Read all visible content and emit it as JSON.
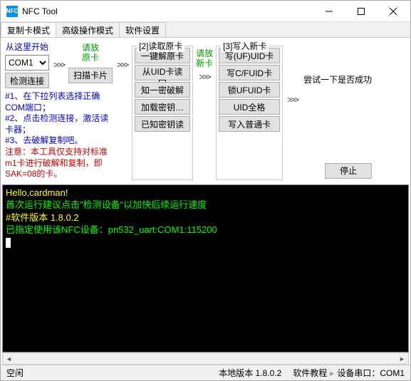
{
  "window": {
    "title": "NFC Tool",
    "icon_text": "NFC"
  },
  "tabs": {
    "t0": "复制卡模式",
    "t1": "高级操作模式",
    "t2": "软件设置"
  },
  "start": {
    "title": "从这里开始",
    "com_selected": "COM1",
    "detect": "检测连接",
    "scan_hint_l1": "请放",
    "scan_hint_l2": "原卡",
    "scan": "扫描卡片"
  },
  "notes": {
    "l1": "#1、在下拉列表选择正确COM端口；",
    "l2": "#2、点击检测连接，激活读卡器；",
    "l3": "#3、去破解复制吧。",
    "warn": "注意：本工具仅支持对标准m1卡进行破解和复制，即SAK=08的卡。"
  },
  "read": {
    "title": "[2]读取原卡",
    "b1": "一键解原卡",
    "b2": "从UID卡读回",
    "b3": "知一密破解",
    "b4": "加载密钥…",
    "b5": "已知密钥读"
  },
  "put_new": {
    "l1": "请放",
    "l2": "新卡"
  },
  "write": {
    "title": "[3]写入新卡",
    "b1": "写(UF)UID卡",
    "b2": "写C/FUID卡",
    "b3": "锁UFUID卡",
    "b4": "UID全格",
    "b5": "写入普通卡"
  },
  "right": {
    "tryit": "尝试一下是否成功",
    "stop": "停止"
  },
  "console": {
    "l1": "Hello,cardman!",
    "l2": "首次运行建议点击\"检测设备\"以加快后续运行速度",
    "l3": "#软件版本 1.8.0.2",
    "l4": "已指定使用该NFC设备：pn532_uart:COM1:115200"
  },
  "status": {
    "idle": "空闲",
    "version": "本地版本 1.8.0.2",
    "tutorial": "软件教程",
    "port_label": "设备串口：",
    "port": "COM1"
  }
}
